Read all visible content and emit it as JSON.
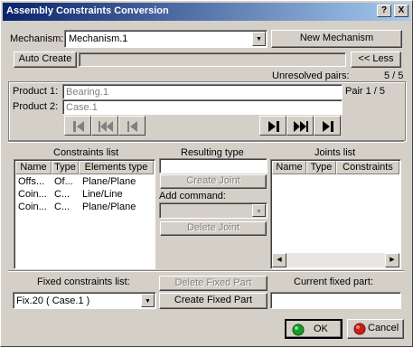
{
  "window": {
    "title": "Assembly Constraints Conversion",
    "help_label": "?",
    "close_label": "X"
  },
  "mechanism": {
    "label": "Mechanism:",
    "value": "Mechanism.1",
    "new_button": "New Mechanism"
  },
  "auto_create": {
    "button": "Auto Create",
    "less_button": "<< Less"
  },
  "unresolved": {
    "label": "Unresolved pairs:",
    "value": "5 / 5"
  },
  "products": {
    "product1_label": "Product 1:",
    "product1_value": "Bearing.1",
    "product2_label": "Product 2:",
    "product2_value": "Case.1",
    "pair_label": "Pair 1 / 5"
  },
  "constraints_list": {
    "title": "Constraints list",
    "columns": [
      "Name",
      "Type",
      "Elements type"
    ],
    "rows": [
      [
        "Offs...",
        "Of...",
        "Plane/Plane"
      ],
      [
        "Coin...",
        "C...",
        "Line/Line"
      ],
      [
        "Coin...",
        "C...",
        "Plane/Plane"
      ]
    ]
  },
  "resulting": {
    "title": "Resulting type",
    "value": "",
    "create_joint": "Create Joint",
    "add_command_label": "Add command:",
    "delete_joint": "Delete Joint"
  },
  "joints_list": {
    "title": "Joints list",
    "columns": [
      "Name",
      "Type",
      "Constraints"
    ]
  },
  "fixed": {
    "constraints_label": "Fixed constraints list:",
    "constraints_value": "Fix.20 ( Case.1 )",
    "delete_button": "Delete Fixed Part",
    "create_button": "Create Fixed Part",
    "current_label": "Current fixed part:",
    "current_value": ""
  },
  "footer": {
    "ok": "OK",
    "cancel": "Cancel"
  },
  "colors": {
    "title_start": "#0a246a",
    "title_end": "#a6caf0",
    "dialog_bg": "#d4d0c8",
    "ok_icon": "#1a9a2a",
    "cancel_icon": "#c8201a"
  }
}
